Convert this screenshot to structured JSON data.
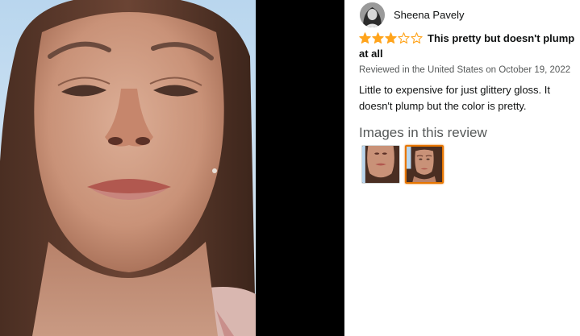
{
  "reviewer": {
    "name": "Sheena Pavely",
    "avatar_icon": "profile-avatar"
  },
  "review": {
    "rating": 3,
    "rating_max": 5,
    "star_color": "#ffa41c",
    "title": "This pretty but doesn't plump at all",
    "meta": "Reviewed in the United States on October 19, 2022",
    "body": "Little to expensive for just glittery gloss. It doesn't plump but the color is pretty."
  },
  "images": {
    "heading": "Images in this review",
    "selected_index": 1,
    "accent_color": "#e77600"
  }
}
